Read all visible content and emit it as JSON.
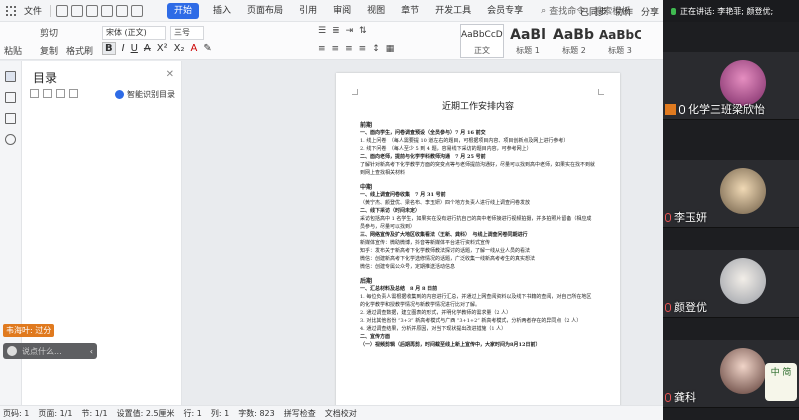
{
  "menubar": {
    "file_label": "文件",
    "tabs": [
      "开始",
      "插入",
      "页面布局",
      "引用",
      "审阅",
      "视图",
      "章节",
      "开发工具",
      "会员专享"
    ],
    "active_tab": "开始",
    "search_placeholder": "查找命令、搜索模板",
    "right_items": [
      "已同步",
      "协作",
      "分享"
    ]
  },
  "toolbar": {
    "paste_label": "粘贴",
    "cut_label": "剪切",
    "copy_label": "复制",
    "format_painter_label": "格式刷",
    "font_name": "宋体 (正文)",
    "font_size": "三号",
    "styles": [
      {
        "preview": "AaBbCcDd",
        "name": "正文"
      },
      {
        "preview": "AaBl",
        "name": "标题 1"
      },
      {
        "preview": "AaBb(",
        "name": "标题 2"
      },
      {
        "preview": "AaBbC",
        "name": "标题 3"
      }
    ]
  },
  "toc": {
    "title": "目录",
    "smart_label": "智能识别目录"
  },
  "chat": {
    "sender": "韦海叶: 过分",
    "placeholder": "说点什么..."
  },
  "document": {
    "title": "近期工作安排内容",
    "sections": [
      {
        "heading": "前期",
        "lines": [
          "一、面向学生，问卷调查预设（全员参与）7 月 16 前交",
          "1. 线上问卷　（每人需要提 10 道左右的题目，可根据项目内容、项目创新点及网上进行参考）",
          "2. 线下问卷　（每人至少 5 到 4 题，容易线下采访的题目内容，可参考网上）",
          "二、面向老师，提前与化学学科教师沟通　7 月 25 号前",
          "了解针对新高考下化学教学方面的突变点等与老师提前沟通好，尽量可以找到高中老师，如果实在找不到就到网上查找相关材料"
        ]
      },
      {
        "heading": "中期",
        "lines": [
          "一、线上调查问卷收集　7 月 31 号前",
          "（黄宁杰、颜登优、梁名布、李玉妍）四个地方负责人进行线上调查问卷发放",
          "二、线下采访（时间未定）",
          "采访包括高中 1 名学生，如果实在没有进行抗自己的高中老师接进行视频拍摄，并多拍照片留备（相应成员参与，尽量可以找到）",
          "三、网络宣传及扩大地区收集看法（王新、龚科）　与线上调查问卷同期进行",
          "新媒体宣传：微助微博，抖音等新媒体平台进行资料式宣传",
          "知乎：发布关于新高考下化学教师教法探讨的话题，了解一线从业人员的看法",
          "微信：创建新高考下化学选修情况的话题，广泛收集一线新高考考生的真实想法",
          "微信：创建专属公众号，定期推送活动信息"
        ]
      },
      {
        "heading": "后期",
        "lines": [
          "一、汇总材料及总结　8 月 8 日前",
          "1. 每位负责人需根据收集到的内容进行汇总，并通过上网查阅资料以及线下书籍的查阅，对自己所在地区的化学教学和授教学情况与新教学情况进行比对了解。",
          "2. 通过调查数据，建立图表的形式，并明化学教师的需求量（2 人）",
          "3. 对比其他省份 “3+3” 新高考模式与广西 “3+1+2” 新高考模式，分析两者存在的异同点（2 人）",
          "4. 通过调查结果，分析并原因，对当下现状提出改进措施（1 人）",
          "二、宣传方面",
          "（一）视频剪辑（后期再剪，时间截至线上新上宣传中，大家时间为8月12日前）"
        ]
      }
    ]
  },
  "statusbar": {
    "items": [
      "页码: 1",
      "页面: 1/1",
      "节: 1/1",
      "设置值: 2.5厘米",
      "行: 1",
      "列: 1",
      "字数: 823",
      "拼写检查",
      "文档校对"
    ]
  },
  "meeting": {
    "speaking_label": "正在讲话: 李艳菲; 颜登优;",
    "participants": [
      {
        "name": "化学三班梁欣怡",
        "avatar_color": "#c24a8b"
      },
      {
        "name": "李玉妍",
        "avatar_color": "#d8b68a"
      },
      {
        "name": "颜登优",
        "avatar_color": "#e8e6e0"
      },
      {
        "name": "龚科",
        "avatar_color": "#e0c2b6"
      }
    ],
    "corner_badge": "中 简"
  },
  "colors": {
    "accent": "#2e6be6",
    "meeting_bg": "#1d1e21",
    "orange": "#e07a1f"
  }
}
